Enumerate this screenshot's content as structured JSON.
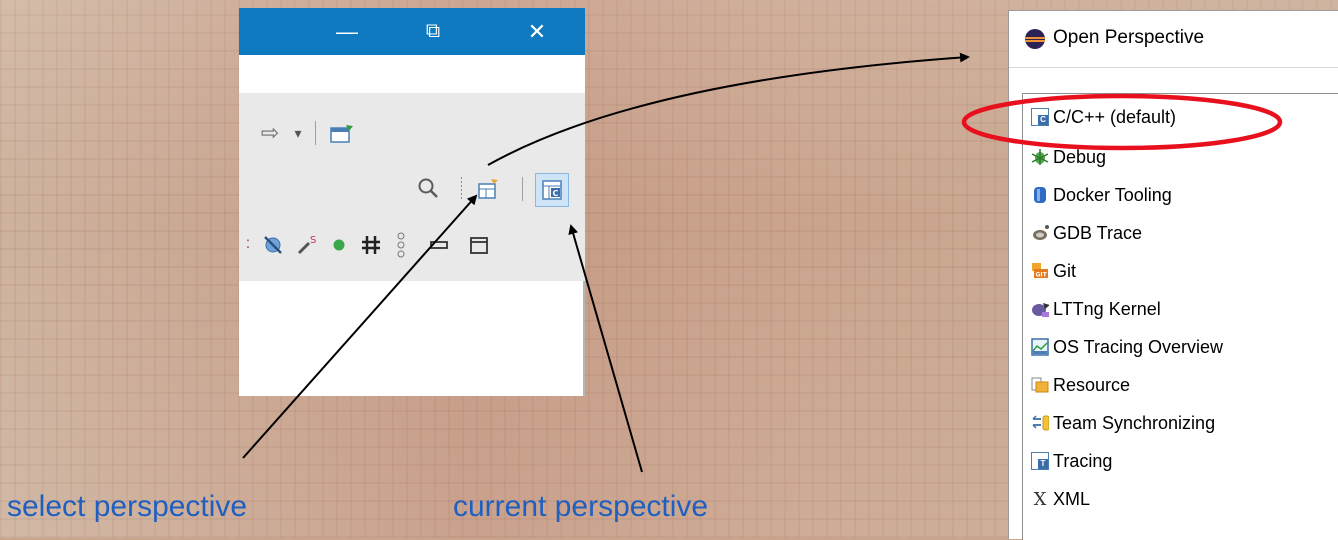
{
  "left_window": {
    "titlebar_buttons": [
      "minimize-icon",
      "restore-icon",
      "close-icon"
    ],
    "titlebar_glyphs": {
      "minimize": "—",
      "restore": "⧉",
      "close": "✕"
    },
    "toolbar_icons": {
      "forward": "⇨",
      "dropdown": "▾",
      "search": "⚲"
    }
  },
  "dialog": {
    "title": "Open Perspective",
    "items": [
      {
        "label": "C/C++ (default)",
        "icon": "cpp-perspective-icon"
      },
      {
        "label": "Debug",
        "icon": "debug-icon"
      },
      {
        "label": "Docker Tooling",
        "icon": "docker-icon"
      },
      {
        "label": "GDB Trace",
        "icon": "gdb-trace-icon"
      },
      {
        "label": "Git",
        "icon": "git-icon"
      },
      {
        "label": "LTTng Kernel",
        "icon": "lttng-icon"
      },
      {
        "label": "OS Tracing Overview",
        "icon": "os-tracing-icon"
      },
      {
        "label": "Resource",
        "icon": "resource-icon"
      },
      {
        "label": "Team Synchronizing",
        "icon": "team-sync-icon"
      },
      {
        "label": "Tracing",
        "icon": "tracing-icon"
      },
      {
        "label": "XML",
        "icon": "xml-icon"
      }
    ]
  },
  "captions": {
    "select": "select perspective",
    "current": "current perspective"
  },
  "colors": {
    "titlebar": "#0f7ac0",
    "highlight_ellipse": "#e8101c",
    "caption": "#1f5fbf"
  }
}
